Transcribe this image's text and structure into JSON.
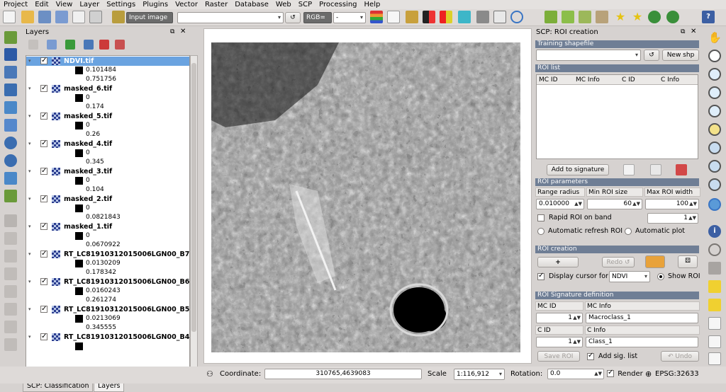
{
  "menu": [
    "Project",
    "Edit",
    "View",
    "Layer",
    "Settings",
    "Plugins",
    "Vector",
    "Raster",
    "Database",
    "Web",
    "SCP",
    "Processing",
    "Help"
  ],
  "toolbar": {
    "input_image_label": "Input image",
    "input_image_value": "",
    "refresh_glyph": "↺",
    "rgb_label": "RGB=",
    "rgb_value": "-"
  },
  "layers_panel": {
    "title": "Layers",
    "items": [
      {
        "name": "NDVI.tif",
        "min": "0.101484",
        "max": "0.751756",
        "selected": true
      },
      {
        "name": "masked_6.tif",
        "min": "0",
        "max": "0.174"
      },
      {
        "name": "masked_5.tif",
        "min": "0",
        "max": "0.26"
      },
      {
        "name": "masked_4.tif",
        "min": "0",
        "max": "0.345"
      },
      {
        "name": "masked_3.tif",
        "min": "0",
        "max": "0.104"
      },
      {
        "name": "masked_2.tif",
        "min": "0",
        "max": "0.0821843"
      },
      {
        "name": "masked_1.tif",
        "min": "0",
        "max": "0.0670922"
      },
      {
        "name": "RT_LC81910312015006LGN00_B7",
        "min": "0.0130209",
        "max": "0.178342"
      },
      {
        "name": "RT_LC81910312015006LGN00_B6",
        "min": "0.0160243",
        "max": "0.261274"
      },
      {
        "name": "RT_LC81910312015006LGN00_B5",
        "min": "0.0213069",
        "max": "0.345555"
      },
      {
        "name": "RT_LC81910312015006LGN00_B4",
        "min": "",
        "max": ""
      }
    ],
    "tabs": [
      "SCP: Classification",
      "Layers"
    ]
  },
  "scp": {
    "title": "SCP: ROI creation",
    "training_header": "Training shapefile",
    "training_value": "",
    "refresh_glyph": "↺",
    "new_shp_label": "New shp",
    "roi_list_header": "ROI list",
    "roi_columns": [
      "MC ID",
      "MC Info",
      "C ID",
      "C Info"
    ],
    "add_signature_label": "Add to signature",
    "roi_params_header": "ROI parameters",
    "range_radius_label": "Range radius",
    "min_roi_label": "Min ROI size",
    "max_roi_label": "Max ROI width",
    "range_radius_value": "0.010000",
    "min_roi_value": "60",
    "max_roi_value": "100",
    "rapid_roi_label": "Rapid ROI on band",
    "rapid_roi_value": "1",
    "auto_refresh_label": "Automatic refresh ROI",
    "auto_plot_label": "Automatic  plot",
    "roi_creation_header": "ROI creation",
    "plus_label": "+",
    "redo_label": "Redo ↺",
    "display_cursor_label": "Display cursor for",
    "display_cursor_value": "NDVI",
    "show_roi_label": "Show ROI",
    "sig_def_header": "ROI Signature definition",
    "mc_id_label": "MC ID",
    "mc_info_label": "MC Info",
    "mc_id_value": "1",
    "mc_info_value": "Macroclass_1",
    "c_id_label": "C ID",
    "c_info_label": "C Info",
    "c_id_value": "1",
    "c_info_value": "Class_1",
    "save_roi_label": "Save ROI",
    "add_sig_list_label": "Add sig. list",
    "undo_label": "↶ Undo"
  },
  "status": {
    "coordinate_label": "Coordinate:",
    "coordinate_value": "310765,4639083",
    "scale_label": "Scale",
    "scale_value": "1:116,912",
    "rotation_label": "Rotation:",
    "rotation_value": "0.0",
    "render_label": "Render",
    "epsg_label": "EPSG:32633"
  },
  "colors": {
    "section_header": "#6f7e95",
    "selected_layer": "#6aa3e0",
    "panel_bg": "#d6d2d0"
  }
}
